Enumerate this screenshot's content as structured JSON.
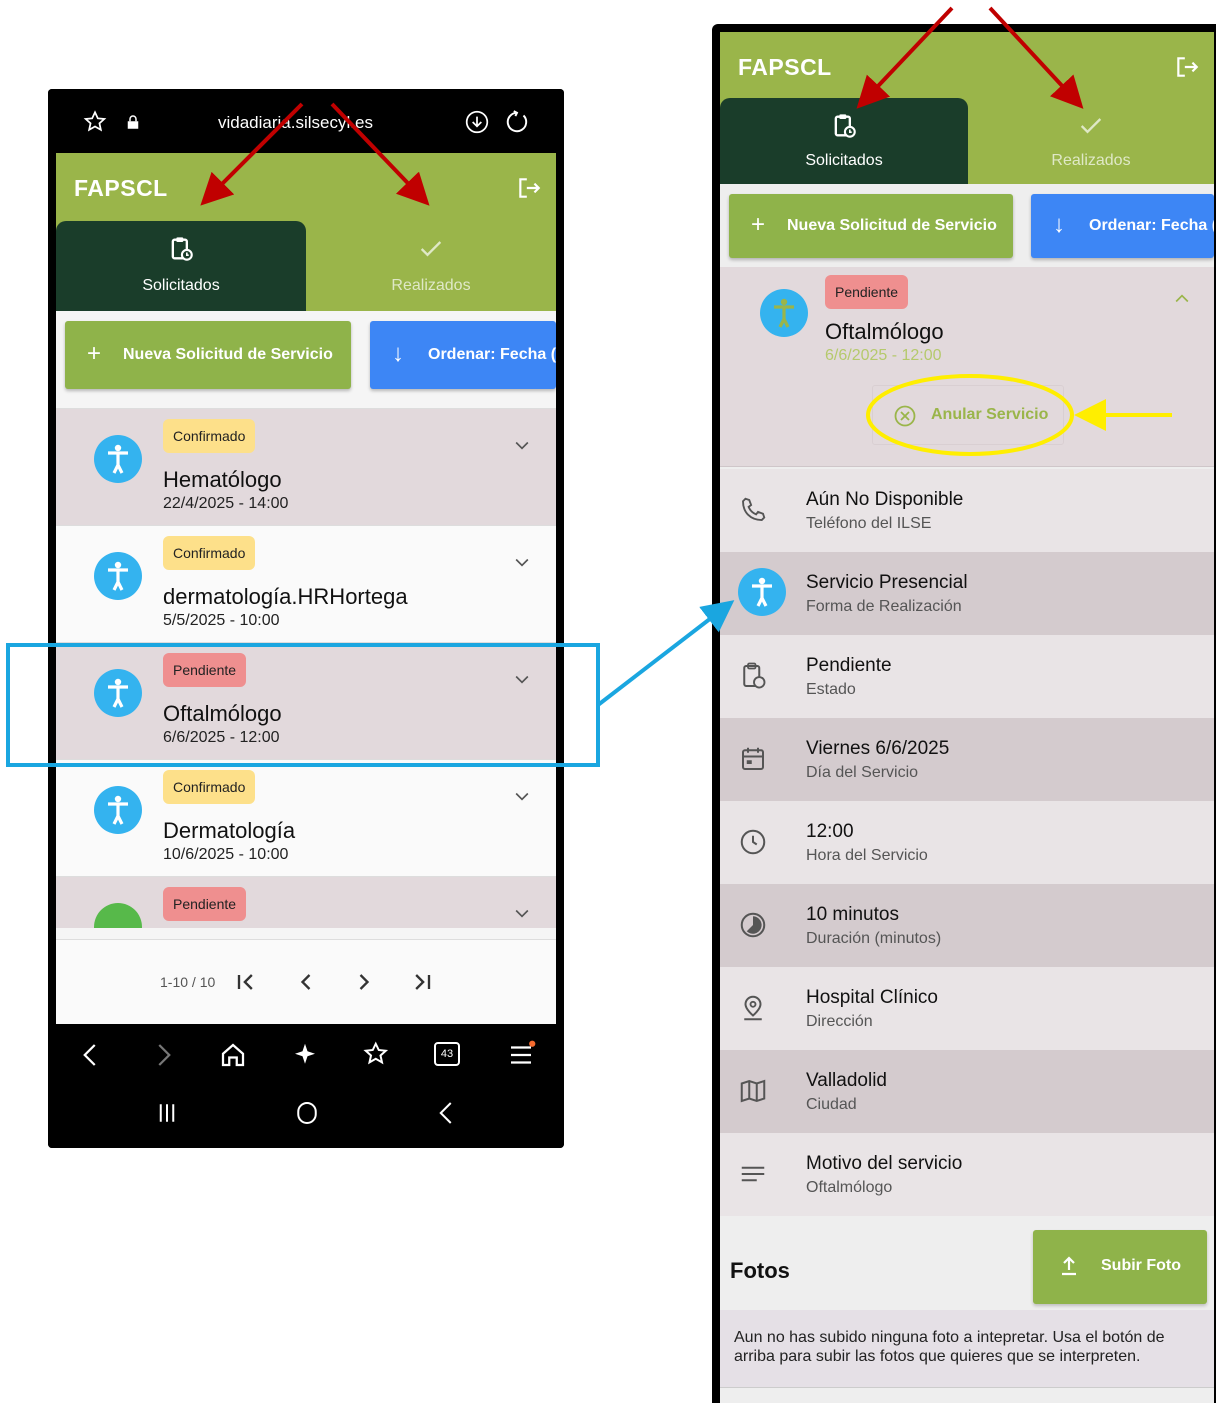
{
  "left_phone": {
    "browser": {
      "url": "vidadiaria.silsecyl.es"
    },
    "app": {
      "title": "FAPSCL",
      "tabs": [
        {
          "label": "Solicitados",
          "icon": "clipboard-clock-icon",
          "active": true
        },
        {
          "label": "Realizados",
          "icon": "check-icon",
          "active": false
        }
      ],
      "actions": {
        "new_request": "Nueva Solicitud de Servicio",
        "sort": "Ordenar: Fecha ("
      },
      "list": [
        {
          "status": "Confirmado",
          "status_color": "#fde08a",
          "name": "Hematólogo",
          "datetime": "22/4/2025 - 14:00",
          "icon": "accessibility-icon"
        },
        {
          "status": "Confirmado",
          "status_color": "#fde08a",
          "name": "dermatología.HRHortega",
          "datetime": "5/5/2025 - 10:00",
          "icon": "accessibility-icon"
        },
        {
          "status": "Pendiente",
          "status_color": "#ef8f8f",
          "name": "Oftalmólogo",
          "datetime": "6/6/2025 - 12:00",
          "icon": "accessibility-icon"
        },
        {
          "status": "Confirmado",
          "status_color": "#fde08a",
          "name": "Dermatología",
          "datetime": "10/6/2025 - 10:00",
          "icon": "accessibility-icon"
        },
        {
          "status": "Pendiente",
          "status_color": "#ef8f8f",
          "name": "",
          "datetime": "",
          "icon": "video-icon"
        }
      ],
      "pagination": {
        "range": "1-10 / 10"
      }
    },
    "nav": {
      "tabs_count": "43"
    }
  },
  "right_phone": {
    "app": {
      "title": "FAPSCL",
      "tabs": [
        {
          "label": "Solicitados",
          "active": true
        },
        {
          "label": "Realizados",
          "active": false
        }
      ],
      "actions": {
        "new_request": "Nueva Solicitud de Servicio",
        "sort": "Ordenar: Fecha ("
      },
      "expanded": {
        "status": "Pendiente",
        "name": "Oftalmólogo",
        "datetime": "6/6/2025 - 12:00",
        "cancel_label": "Anular Servicio"
      },
      "details": [
        {
          "value": "Aún No Disponible",
          "label": "Teléfono del ILSE",
          "icon": "phone-icon"
        },
        {
          "value": "Servicio Presencial",
          "label": "Forma de Realización",
          "icon": "accessibility-icon"
        },
        {
          "value": "Pendiente",
          "label": "Estado",
          "icon": "clipboard-clock-icon"
        },
        {
          "value": "Viernes 6/6/2025",
          "label": "Día del Servicio",
          "icon": "calendar-icon"
        },
        {
          "value": "12:00",
          "label": "Hora del Servicio",
          "icon": "clock-icon"
        },
        {
          "value": "10 minutos",
          "label": "Duración (minutos)",
          "icon": "timer-icon"
        },
        {
          "value": "Hospital Clínico",
          "label": "Dirección",
          "icon": "location-pin-icon"
        },
        {
          "value": "Valladolid",
          "label": "Ciudad",
          "icon": "map-icon"
        },
        {
          "value": "Motivo del servicio",
          "label": "Oftalmólogo",
          "icon": "notes-icon"
        }
      ],
      "photos": {
        "title": "Fotos",
        "upload_label": "Subir Foto",
        "empty_message": "Aun no has subido ninguna foto a intepretar. Usa el botón de arriba para subir las fotos que quieres que se interpreten."
      }
    }
  },
  "colors": {
    "app_green": "#9ab54a",
    "tab_active": "#1a3d2a",
    "sort_blue": "#3d86f5",
    "annotation_red": "#c00000",
    "annotation_blue": "#1aa6e0",
    "annotation_yellow": "#ffee00"
  }
}
